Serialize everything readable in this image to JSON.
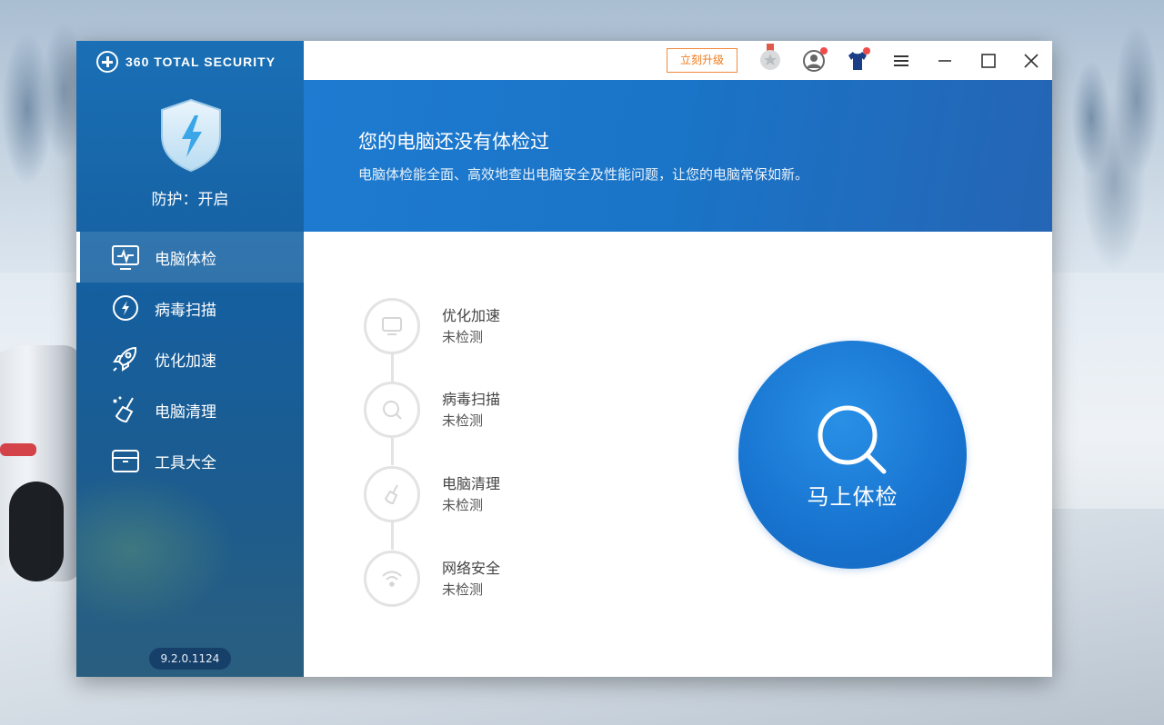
{
  "app": {
    "brand": "360 TOTAL SECURITY",
    "version": "9.2.0.1124"
  },
  "sidebar": {
    "protection_status": "防护：开启",
    "items": [
      {
        "label": "电脑体检",
        "icon": "monitor-pulse-icon",
        "active": true
      },
      {
        "label": "病毒扫描",
        "icon": "bolt-circle-icon",
        "active": false
      },
      {
        "label": "优化加速",
        "icon": "rocket-icon",
        "active": false
      },
      {
        "label": "电脑清理",
        "icon": "broom-icon",
        "active": false
      },
      {
        "label": "工具大全",
        "icon": "toolbox-icon",
        "active": false
      }
    ]
  },
  "titlebar": {
    "upgrade_label": "立刻升级",
    "icons": [
      "medal-icon",
      "user-avatar-icon",
      "tshirt-icon",
      "menu-icon",
      "minimize-icon",
      "maximize-icon",
      "close-icon"
    ]
  },
  "banner": {
    "title": "您的电脑还没有体检过",
    "subtitle": "电脑体检能全面、高效地查出电脑安全及性能问题，让您的电脑常保如新。"
  },
  "checks": [
    {
      "name": "优化加速",
      "status": "未检测",
      "icon": "monitor-icon"
    },
    {
      "name": "病毒扫描",
      "status": "未检测",
      "icon": "search-icon"
    },
    {
      "name": "电脑清理",
      "status": "未检测",
      "icon": "broom-icon"
    },
    {
      "name": "网络安全",
      "status": "未检测",
      "icon": "wifi-icon"
    }
  ],
  "scan_button": {
    "label": "马上体检"
  },
  "colors": {
    "sidebar": "#1a6fb5",
    "banner": "#1e7bd0",
    "scan_button": "#1773cf",
    "upgrade_accent": "#ef7a1a",
    "notification_dot": "#f04b4b"
  }
}
